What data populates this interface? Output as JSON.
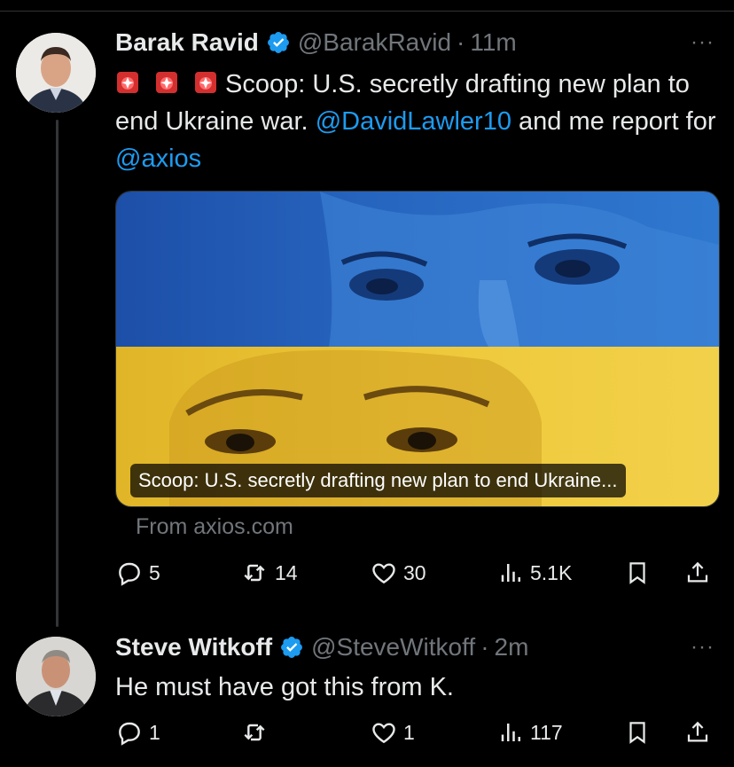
{
  "tweets": [
    {
      "name": "Barak Ravid",
      "handle": "@BarakRavid",
      "separator": "·",
      "time": "11m",
      "text_main": "Scoop: U.S. secretly drafting new plan to end Ukraine war.",
      "mention1": "@DavidLawler10",
      "text_mid": "and me report for",
      "mention2": "@axios",
      "card": {
        "caption": "Scoop: U.S. secretly drafting new plan to end Ukraine...",
        "source": "From axios.com"
      },
      "actions": {
        "replies": "5",
        "reposts": "14",
        "likes": "30",
        "views": "5.1K"
      }
    },
    {
      "name": "Steve Witkoff",
      "handle": "@SteveWitkoff",
      "separator": "·",
      "time": "2m",
      "text": "He must have got this from K.",
      "actions": {
        "replies": "1",
        "reposts": "",
        "likes": "1",
        "views": "117"
      }
    }
  ],
  "more_label": "···",
  "colors": {
    "background": "#000000",
    "text": "#e7e9ea",
    "muted": "#71767b",
    "link": "#1d9bf0",
    "verified": "#1d9bf0"
  },
  "icons": [
    "siren-icon",
    "verified-badge-icon",
    "reply-icon",
    "repost-icon",
    "like-icon",
    "views-icon",
    "bookmark-icon",
    "share-icon",
    "more-icon"
  ]
}
